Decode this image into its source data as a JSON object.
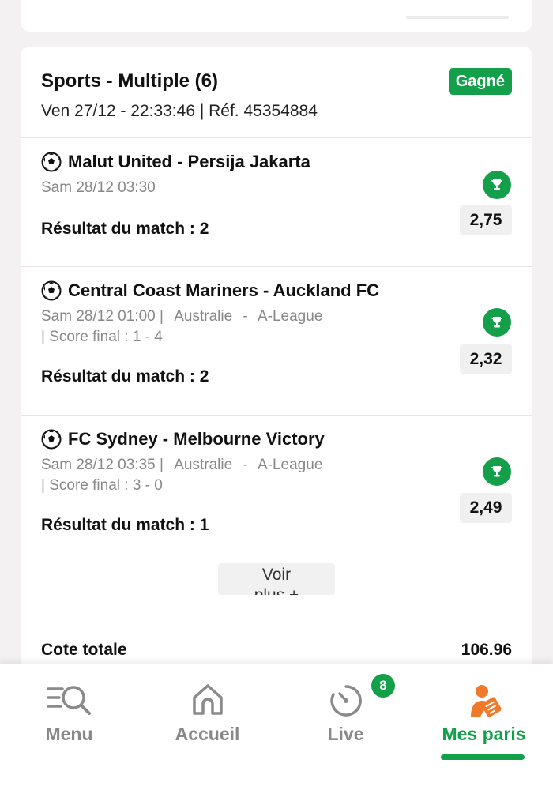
{
  "bet": {
    "title": "Sports - Multiple (6)",
    "status": "Gagné",
    "meta": "Ven 27/12 - 22:33:46 | Réf. 45354884",
    "colors": {
      "win": "#14a04a",
      "muted": "#888888"
    }
  },
  "selections": [
    {
      "match": "Malut United - Persija Jakarta",
      "date": "Sam 28/12 03:30",
      "market": "Résultat du match : 2",
      "odd": "2,75"
    },
    {
      "match": "Central Coast Mariners - Auckland FC",
      "date": "Sam 28/12 01:00 |",
      "country": "Australie",
      "dash": "-",
      "league": "A-League",
      "score": "| Score final : 1 - 4",
      "market": "Résultat du match : 2",
      "odd": "2,32"
    },
    {
      "match": "FC Sydney - Melbourne Victory",
      "date": "Sam 28/12 03:35 |",
      "country": "Australie",
      "dash": "-",
      "league": "A-League",
      "score": "| Score final : 3 - 0",
      "market": "Résultat du match : 1",
      "odd": "2,49"
    }
  ],
  "more_button": {
    "line1": "Voir",
    "line2": "plus +"
  },
  "total": {
    "label": "Cote totale",
    "value": "106.96"
  },
  "nav": {
    "items": [
      {
        "label": "Menu",
        "icon": "menu-search-icon"
      },
      {
        "label": "Accueil",
        "icon": "home-icon"
      },
      {
        "label": "Live",
        "icon": "stopwatch-icon",
        "badge": "8"
      },
      {
        "label": "Mes paris",
        "icon": "bets-user-icon",
        "active": true
      }
    ]
  }
}
